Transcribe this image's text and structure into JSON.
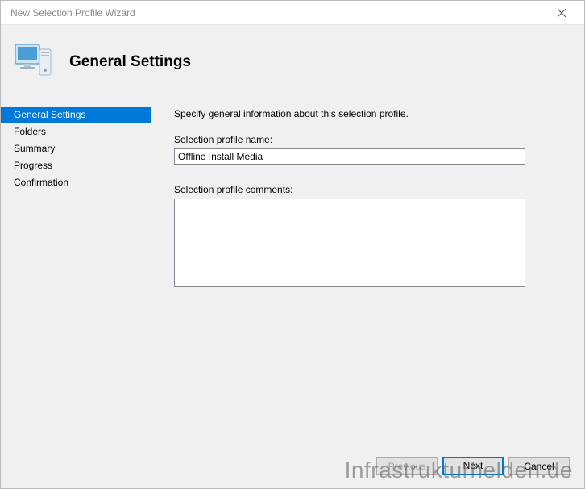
{
  "window": {
    "title": "New Selection Profile Wizard"
  },
  "header": {
    "title": "General Settings"
  },
  "sidebar": {
    "steps": [
      {
        "label": "General Settings",
        "active": true
      },
      {
        "label": "Folders",
        "active": false
      },
      {
        "label": "Summary",
        "active": false
      },
      {
        "label": "Progress",
        "active": false
      },
      {
        "label": "Confirmation",
        "active": false
      }
    ]
  },
  "main": {
    "description": "Specify general information about this selection profile.",
    "name_label": "Selection profile name:",
    "name_value": "Offline Install Media",
    "comments_label": "Selection profile comments:",
    "comments_value": ""
  },
  "footer": {
    "previous": "Previous",
    "next": "Next",
    "cancel": "Cancel"
  },
  "watermark": "Infrastrukturhelden.de"
}
